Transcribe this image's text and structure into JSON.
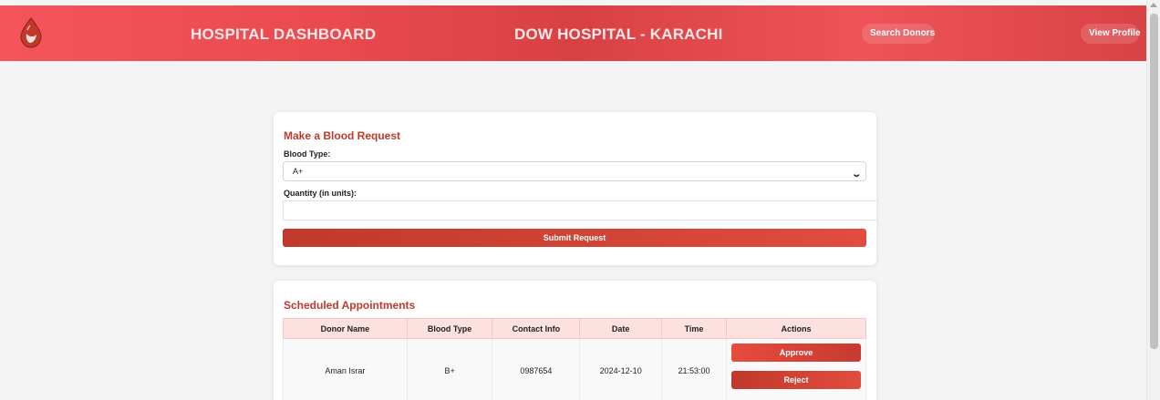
{
  "header": {
    "left_title": "HOSPITAL DASHBOARD",
    "center_title": "DOW HOSPITAL - KARACHI",
    "search_label": "Search Donors",
    "profile_label": "View Profile",
    "logo_icon": "blood-drop-icon",
    "colors": {
      "accent": "#e84a4e",
      "primary": "#c0392b"
    }
  },
  "request": {
    "title": "Make a Blood Request",
    "blood_type_label": "Blood Type:",
    "blood_type_value": "A+",
    "quantity_label": "Quantity (in units):",
    "quantity_value": "",
    "submit_label": "Submit Request"
  },
  "appointments": {
    "title": "Scheduled Appointments",
    "columns": [
      "Donor Name",
      "Blood Type",
      "Contact Info",
      "Date",
      "Time",
      "Actions"
    ],
    "rows": [
      {
        "donor_name": "Aman Israr",
        "blood_type": "B+",
        "contact": "0987654",
        "date": "2024-12-10",
        "time": "21:53:00",
        "approve_label": "Approve",
        "reject_label": "Reject"
      }
    ]
  }
}
